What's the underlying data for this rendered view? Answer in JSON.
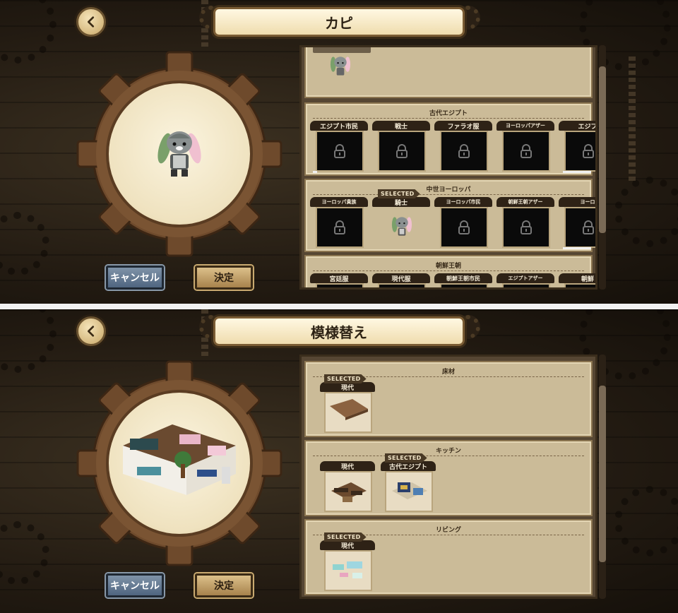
{
  "top_screen": {
    "title": "カピ",
    "cancel_label": "キャンセル",
    "ok_label": "決定",
    "selected_badge": "SELECTED",
    "sections": [
      {
        "title": "",
        "items": []
      },
      {
        "title": "古代エジプト",
        "items": [
          {
            "label": "エジプト市民",
            "locked": true
          },
          {
            "label": "戦士",
            "locked": true
          },
          {
            "label": "ファラオ服",
            "locked": true
          },
          {
            "label": "ヨーロッパアザー",
            "locked": true
          },
          {
            "label": "エジプ",
            "locked": true
          }
        ]
      },
      {
        "title": "中世ヨーロッパ",
        "items": [
          {
            "label": "ヨーロッパ貴族",
            "locked": true
          },
          {
            "label": "騎士",
            "locked": false,
            "selected": true
          },
          {
            "label": "ヨーロッパ市民",
            "locked": true
          },
          {
            "label": "朝鮮王朝アザー",
            "locked": true
          },
          {
            "label": "ヨーロ",
            "locked": true
          }
        ]
      },
      {
        "title": "朝鮮王朝",
        "items": [
          {
            "label": "宮廷服"
          },
          {
            "label": "現代服"
          },
          {
            "label": "朝鮮王朝市民"
          },
          {
            "label": "エジプトアザー"
          },
          {
            "label": "朝鮮"
          }
        ]
      }
    ]
  },
  "bottom_screen": {
    "title": "模様替え",
    "cancel_label": "キャンセル",
    "ok_label": "決定",
    "selected_badge": "SELECTED",
    "sections": [
      {
        "title": "床材",
        "items": [
          {
            "label": "現代",
            "selected": true
          }
        ]
      },
      {
        "title": "キッチン",
        "items": [
          {
            "label": "現代"
          },
          {
            "label": "古代エジプト",
            "selected": true
          }
        ]
      },
      {
        "title": "リビング",
        "items": [
          {
            "label": "現代",
            "selected": true
          }
        ]
      }
    ]
  },
  "icons": {
    "back": "chevron-left-icon",
    "lock": "lock-icon"
  }
}
